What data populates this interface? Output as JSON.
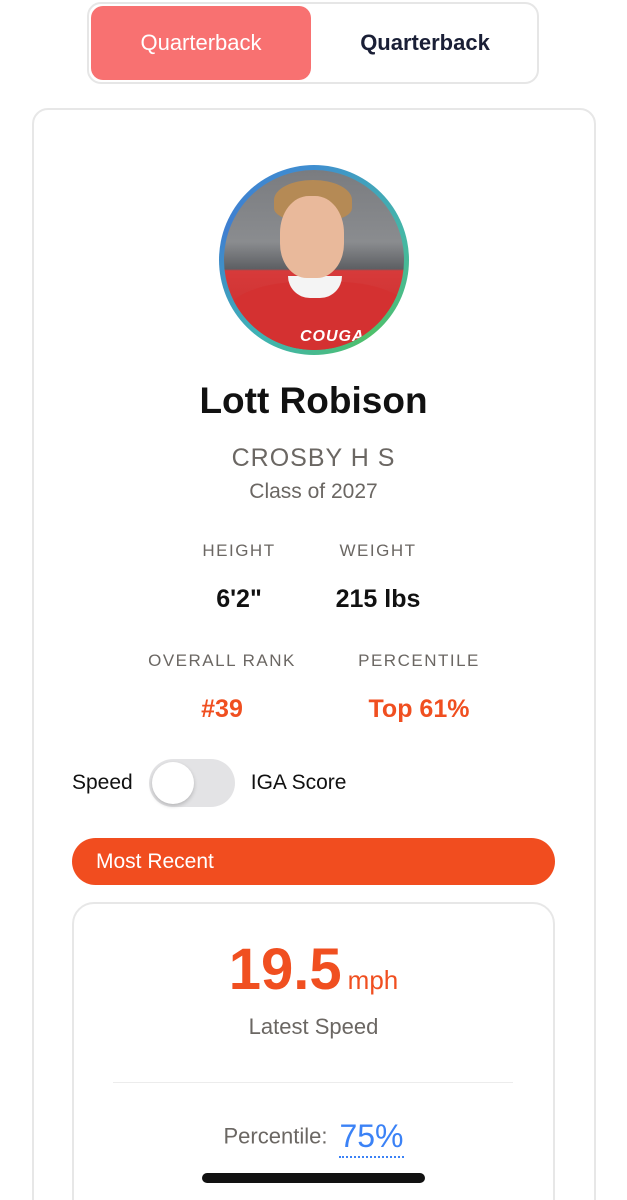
{
  "tabs": [
    {
      "label": "Quarterback",
      "active": true
    },
    {
      "label": "Quarterback",
      "active": false
    }
  ],
  "player": {
    "name": "Lott Robison",
    "school": "CROSBY H S",
    "class_year": "Class of 2027",
    "avatar_text": "COUGA"
  },
  "stats": {
    "height_label": "HEIGHT",
    "height_value": "6'2\"",
    "weight_label": "WEIGHT",
    "weight_value": "215 lbs",
    "rank_label": "OVERALL RANK",
    "rank_value": "#39",
    "percentile_label": "PERCENTILE",
    "percentile_value": "Top 61%"
  },
  "toggle": {
    "left_label": "Speed",
    "right_label": "IGA Score",
    "on": false
  },
  "recent": {
    "banner": "Most Recent",
    "speed_value": "19.5",
    "speed_unit": "mph",
    "speed_caption": "Latest Speed",
    "percentile_label": "Percentile:",
    "percentile_value": "75%"
  },
  "colors": {
    "accent": "#f14d1f",
    "tab_active": "#f87171",
    "link_blue": "#3b82f6"
  }
}
